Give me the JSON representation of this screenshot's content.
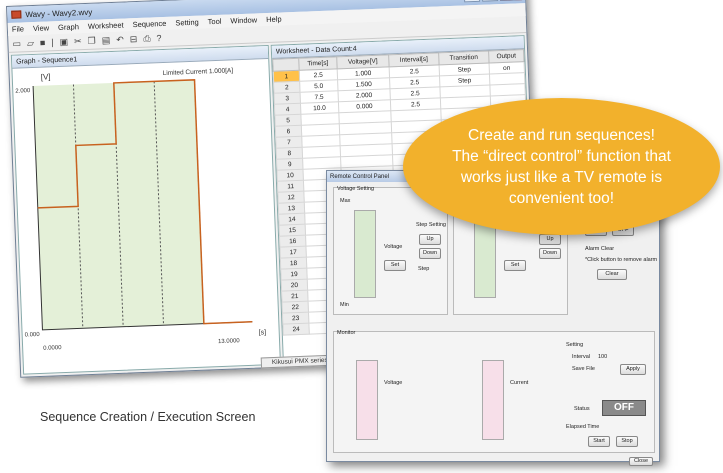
{
  "main_window": {
    "title": "Wavy - Wavy2.wvy",
    "menu": [
      "File",
      "View",
      "Graph",
      "Worksheet",
      "Sequence",
      "Setting",
      "Tool",
      "Window",
      "Help"
    ],
    "toolbar_icons": [
      "new-icon",
      "open-icon",
      "save-icon",
      "separator",
      "select-icon",
      "cut-icon",
      "copy-icon",
      "paste-icon",
      "undo-icon",
      "ruler-icon",
      "print-icon",
      "help-icon"
    ]
  },
  "graph": {
    "title": "Graph - Sequence1",
    "ylabel": "[V]",
    "xlabel": "[s]",
    "limited_current": "Limited Current 1.000[A]",
    "y_top": "2.000",
    "y_bottom": "0.000",
    "x_left": "0.0000",
    "x_right": "13.0000"
  },
  "chart_data": {
    "type": "line",
    "x": [
      0,
      2.5,
      2.5,
      5.0,
      5.0,
      7.5,
      7.5,
      10.0,
      10.0,
      13.0
    ],
    "y": [
      1.0,
      1.0,
      1.5,
      1.5,
      2.0,
      2.0,
      2.0,
      2.0,
      0.0,
      0.0
    ],
    "xlim": [
      0,
      13
    ],
    "ylim": [
      0,
      2
    ],
    "xlabel": "[s]",
    "ylabel": "[V]"
  },
  "worksheet": {
    "title": "Worksheet - Data Count:4",
    "columns": [
      "",
      "Time[s]",
      "Voltage[V]",
      "Interval[s]",
      "Transition",
      "Output"
    ],
    "rows": [
      [
        "1",
        "2.5",
        "1.000",
        "2.5",
        "Step",
        "on"
      ],
      [
        "2",
        "5.0",
        "1.500",
        "2.5",
        "Step",
        ""
      ],
      [
        "3",
        "7.5",
        "2.000",
        "2.5",
        "",
        ""
      ],
      [
        "4",
        "10.0",
        "0.000",
        "2.5",
        "",
        ""
      ],
      [
        "5",
        "",
        "",
        "",
        "",
        ""
      ],
      [
        "6",
        "",
        "",
        "",
        "",
        ""
      ],
      [
        "7",
        "",
        "",
        "",
        "",
        ""
      ],
      [
        "8",
        "",
        "",
        "",
        "",
        ""
      ],
      [
        "9",
        "",
        "",
        "",
        "",
        ""
      ],
      [
        "10",
        "",
        "",
        "",
        "",
        ""
      ],
      [
        "11",
        "",
        "",
        "",
        "",
        ""
      ],
      [
        "12",
        "",
        "",
        "",
        "",
        ""
      ],
      [
        "13",
        "",
        "",
        "",
        "",
        ""
      ],
      [
        "14",
        "",
        "",
        "",
        "",
        ""
      ],
      [
        "15",
        "",
        "",
        "",
        "",
        ""
      ],
      [
        "16",
        "",
        "",
        "",
        "",
        ""
      ],
      [
        "17",
        "",
        "",
        "",
        "",
        ""
      ],
      [
        "18",
        "",
        "",
        "",
        "",
        ""
      ],
      [
        "19",
        "",
        "",
        "",
        "",
        ""
      ],
      [
        "20",
        "",
        "",
        "",
        "",
        ""
      ],
      [
        "21",
        "",
        "",
        "",
        "",
        ""
      ],
      [
        "22",
        "",
        "",
        "",
        "",
        ""
      ],
      [
        "23",
        "",
        "",
        "",
        "",
        ""
      ],
      [
        "24",
        "",
        "",
        "",
        "",
        ""
      ]
    ],
    "status": "Kikusui PMX series"
  },
  "remote": {
    "title": "Remote Control Panel",
    "voltage_setting": "Voltage Setting",
    "max": "Max",
    "min": "Min",
    "voltage_label": "Voltage",
    "set": "Set",
    "step_setting": "Step Setting",
    "up": "Up",
    "down": "Down",
    "step": "Step",
    "on": "ON",
    "off_btn": "OFF",
    "alarm_clear": "Alarm Clear",
    "alarm_note": "*Click button to remove alarm",
    "clear": "Clear",
    "monitor": "Monitor",
    "voltage_cb": "Voltage",
    "current_cb": "Current",
    "setting": "Setting",
    "interval": "Interval",
    "interval_value": "100",
    "save_file": "Save File",
    "apply": "Apply",
    "status": "Status",
    "status_value": "OFF",
    "elapsed": "Elapsed Time",
    "start": "Start",
    "stop": "Stop",
    "close": "Close"
  },
  "bubble": {
    "lines": [
      "Create and run sequences!",
      "The “direct control” function that",
      "works just like a TV remote is",
      "convenient too!"
    ]
  },
  "caption": "Sequence Creation / Execution Screen"
}
